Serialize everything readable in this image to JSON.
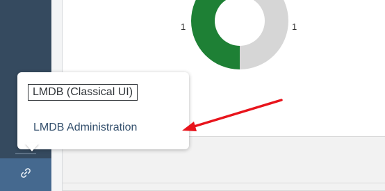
{
  "menu": {
    "items": [
      {
        "label": "LMDB (Classical UI)",
        "focused": true
      },
      {
        "label": "LMDB Administration",
        "focused": false
      }
    ]
  },
  "chart": {
    "left_value": "1",
    "right_value": "1"
  },
  "chart_data": {
    "type": "pie",
    "style": "donut",
    "slices": [
      {
        "value": 1,
        "color": "#1e8035"
      },
      {
        "value": 1,
        "color": "#d6d6d6"
      }
    ],
    "data_labels": [
      "1",
      "1"
    ]
  },
  "sidebar": {
    "link_icon": "link-icon"
  },
  "annotation": {
    "arrow_color": "#e8141c"
  },
  "colors": {
    "sidebar": "#354a5f",
    "sidebar_button": "#45698f",
    "donut_primary": "#1e8035",
    "donut_secondary": "#d6d6d6"
  }
}
